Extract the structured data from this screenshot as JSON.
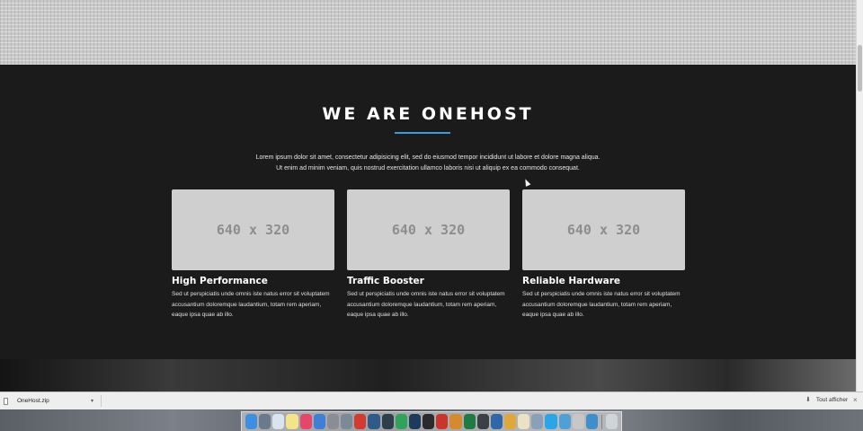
{
  "section": {
    "title": "WE ARE ONEHOST",
    "intro_line1": "Lorem ipsum dolor sit amet, consectetur adipisicing elit, sed do eiusmod tempor incididunt ut labore et dolore magna aliqua.",
    "intro_line2": "Ut enim ad minim veniam, quis nostrud exercitation ullamco laboris nisi ut aliquip ex ea commodo consequat.",
    "accent_color": "#3a9bd9"
  },
  "features": [
    {
      "image_label": "640 x 320",
      "title": "High Performance",
      "text": "Sed ut perspiciatis unde omnis iste natus error sit voluptatem accusantium doloremque laudantium, totam rem aperiam, eaque ipsa quae ab illo."
    },
    {
      "image_label": "640 x 320",
      "title": "Traffic Booster",
      "text": "Sed ut perspiciatis unde omnis iste natus error sit voluptatem accusantium doloremque laudantium, totam rem aperiam, eaque ipsa quae ab illo."
    },
    {
      "image_label": "640 x 320",
      "title": "Reliable Hardware",
      "text": "Sed ut perspiciatis unde omnis iste natus error sit voluptatem accusantium doloremque laudantium, totam rem aperiam, eaque ipsa quae ab illo."
    }
  ],
  "download_bar": {
    "file_name": "OneHost.zip",
    "caret": "▾",
    "show_all": "Tout afficher",
    "close": "×"
  },
  "dock": {
    "apps": [
      {
        "icon": "finder-icon",
        "color": "#3f8fe0"
      },
      {
        "icon": "launchpad-icon",
        "color": "#6a7a8c"
      },
      {
        "icon": "safari-icon",
        "color": "#d9e4ef"
      },
      {
        "icon": "notes-icon",
        "color": "#f3e38a"
      },
      {
        "icon": "itunes-icon",
        "color": "#e4476a"
      },
      {
        "icon": "app-store-icon",
        "color": "#3f7fd6"
      },
      {
        "icon": "system-preferences-icon",
        "color": "#8a8e94"
      },
      {
        "icon": "disk-utility-icon",
        "color": "#7b8a96"
      },
      {
        "icon": "red-app-icon",
        "color": "#d23b2f"
      },
      {
        "icon": "screen-sharing-icon",
        "color": "#2f5a8a"
      },
      {
        "icon": "activity-monitor-icon",
        "color": "#2c3f4a"
      },
      {
        "icon": "green-app-icon",
        "color": "#2fa35a"
      },
      {
        "icon": "photoshop-icon",
        "color": "#1f3b5c"
      },
      {
        "icon": "terminal-icon",
        "color": "#2b2b2b"
      },
      {
        "icon": "filezilla-icon",
        "color": "#c8352d"
      },
      {
        "icon": "chart-app-icon",
        "color": "#d68a2f"
      },
      {
        "icon": "excel-icon",
        "color": "#1f7a44"
      },
      {
        "icon": "dark-app-icon",
        "color": "#3b3f46"
      },
      {
        "icon": "window-app-icon",
        "color": "#2f67a8"
      },
      {
        "icon": "cyberduck-icon",
        "color": "#e0a83a"
      },
      {
        "icon": "chrome-icon",
        "color": "#e9e2c4"
      },
      {
        "icon": "preview-icon",
        "color": "#8aa0b8"
      },
      {
        "icon": "skype-icon",
        "color": "#2aa6e6"
      },
      {
        "icon": "trello-icon",
        "color": "#4fa0d6"
      },
      {
        "icon": "sequel-pro-icon",
        "color": "#c7c7c7"
      },
      {
        "icon": "globe-icon",
        "color": "#3e8ec9"
      },
      {
        "icon": "trash-icon",
        "color": "#cfd4d8"
      }
    ]
  }
}
